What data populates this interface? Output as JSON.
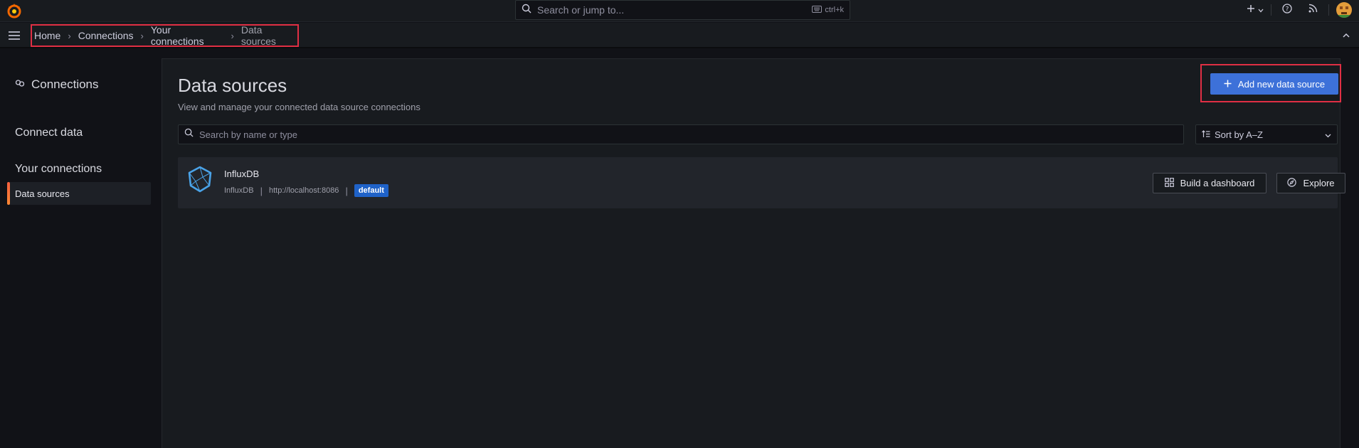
{
  "topbar": {
    "logo_icon": "grafana-logo-icon",
    "search": {
      "placeholder": "Search or jump to...",
      "shortcut": "ctrl+k"
    },
    "icons": [
      "plus-icon",
      "chevron-down-icon",
      "help-icon",
      "rss-icon",
      "avatar"
    ]
  },
  "breadcrumb": {
    "items": [
      "Home",
      "Connections",
      "Your connections",
      "Data sources"
    ]
  },
  "sidebar": {
    "title": "Connections",
    "connect_data": "Connect data",
    "your_connections": "Your connections",
    "active_item": "Data sources"
  },
  "main": {
    "title": "Data sources",
    "subtitle": "View and manage your connected data source connections",
    "add_button": "Add new data source",
    "search_placeholder": "Search by name or type",
    "sort_label": "Sort by A–Z"
  },
  "datasources": [
    {
      "name": "InfluxDB",
      "type": "InfluxDB",
      "url": "http://localhost:8086",
      "badge": "default",
      "actions": {
        "dashboard": "Build a dashboard",
        "explore": "Explore"
      }
    }
  ],
  "colors": {
    "primary": "#3d71d9",
    "badge": "#1f62c8",
    "highlight": "#e02f44",
    "active_accent": "#ff8833"
  }
}
